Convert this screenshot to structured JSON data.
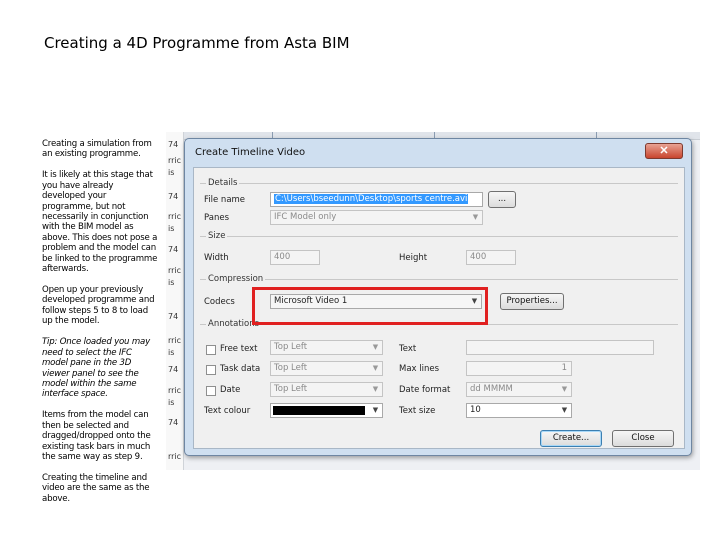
{
  "slide": {
    "title": "Creating a 4D Programme from Asta BIM",
    "notes": [
      {
        "text": "Creating a simulation from an existing programme.",
        "italic": false
      },
      {
        "text": "It is likely at this stage that you have already developed your programme, but not necessarily in conjunction with the BIM model as above. This does not pose a problem and the model can be linked to the programme afterwards.",
        "italic": false
      },
      {
        "text": "Open up your previously developed programme and follow steps 5 to 8 to load up the model.",
        "italic": false
      },
      {
        "text": "Tip: Once loaded you may need to select the IFC model pane in the 3D viewer panel to see the model within the same interface space.",
        "italic": true
      },
      {
        "text": "Items from the model can then be selected and dragged/dropped onto the existing task bars in much the same way as step 9.",
        "italic": false
      },
      {
        "text": "Creating the timeline and video are the same as the above.",
        "italic": false
      }
    ]
  },
  "background_app": {
    "row_labels": [
      "74",
      "rric",
      "is",
      "74",
      "rric",
      "is",
      "74",
      "rric",
      "is",
      "74",
      "rric",
      "is",
      "74",
      "rric",
      "is",
      "74",
      "rric"
    ]
  },
  "dialog": {
    "title": "Create Timeline Video",
    "close_label": "✕",
    "details": {
      "group_label": "Details",
      "file_name_label": "File name",
      "file_name_value": "C:\\Users\\bseedunn\\Desktop\\sports centre.avi",
      "browse_label": "...",
      "panes_label": "Panes",
      "panes_value": "IFC Model only"
    },
    "size": {
      "group_label": "Size",
      "width_label": "Width",
      "width_value": "400",
      "height_label": "Height",
      "height_value": "400"
    },
    "compression": {
      "group_label": "Compression",
      "codecs_label": "Codecs",
      "codecs_value": "Microsoft Video 1",
      "properties_label": "Properties..."
    },
    "annotations": {
      "group_label": "Annotations",
      "free_text_label": "Free text",
      "free_text_position": "Top Left",
      "task_data_label": "Task data",
      "task_data_position": "Top Left",
      "date_label": "Date",
      "date_position": "Top Left",
      "text_colour_label": "Text colour",
      "text_label": "Text",
      "text_value": "",
      "max_lines_label": "Max lines",
      "max_lines_value": "1",
      "date_format_label": "Date format",
      "date_format_value": "dd MMMM",
      "text_size_label": "Text size",
      "text_size_value": "10"
    },
    "create_label": "Create...",
    "close_button_label": "Close"
  },
  "colors": {
    "highlight": "#e02020",
    "selection": "#3399ff",
    "dialog_frame": "#cfdff0"
  }
}
